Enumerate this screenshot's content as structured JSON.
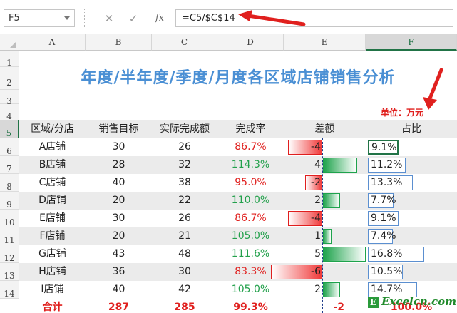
{
  "formula_bar": {
    "name_box": "F5",
    "cancel_glyph": "✕",
    "enter_glyph": "✓",
    "fx_label": "fx",
    "formula": "=C5/$C$14"
  },
  "columns": [
    "A",
    "B",
    "C",
    "D",
    "E",
    "F"
  ],
  "rows": [
    "1",
    "2",
    "3",
    "4",
    "5",
    "6",
    "7",
    "8",
    "9",
    "10",
    "11",
    "12",
    "13",
    "14"
  ],
  "title": "年度/半年度/季度/月度各区域店铺销售分析",
  "unit": "单位：万元",
  "headers": {
    "region": "区域/分店",
    "target": "销售目标",
    "actual": "实际完成额",
    "rate": "完成率",
    "diff": "差额",
    "share": "占比"
  },
  "table": [
    {
      "store": "A店铺",
      "target": "30",
      "actual": "26",
      "rate": "86.7%",
      "rate_good": false,
      "diff": "-4",
      "diff_value": -4,
      "share": "9.1%",
      "share_value": 9.1
    },
    {
      "store": "B店铺",
      "target": "28",
      "actual": "32",
      "rate": "114.3%",
      "rate_good": true,
      "diff": "4",
      "diff_value": 4,
      "share": "11.2%",
      "share_value": 11.2
    },
    {
      "store": "C店铺",
      "target": "40",
      "actual": "38",
      "rate": "95.0%",
      "rate_good": false,
      "diff": "-2",
      "diff_value": -2,
      "share": "13.3%",
      "share_value": 13.3
    },
    {
      "store": "D店铺",
      "target": "20",
      "actual": "22",
      "rate": "110.0%",
      "rate_good": true,
      "diff": "2",
      "diff_value": 2,
      "share": "7.7%",
      "share_value": 7.7
    },
    {
      "store": "E店铺",
      "target": "30",
      "actual": "26",
      "rate": "86.7%",
      "rate_good": false,
      "diff": "-4",
      "diff_value": -4,
      "share": "9.1%",
      "share_value": 9.1
    },
    {
      "store": "F店铺",
      "target": "20",
      "actual": "21",
      "rate": "105.0%",
      "rate_good": true,
      "diff": "1",
      "diff_value": 1,
      "share": "7.4%",
      "share_value": 7.4
    },
    {
      "store": "G店铺",
      "target": "43",
      "actual": "48",
      "rate": "111.6%",
      "rate_good": true,
      "diff": "5",
      "diff_value": 5,
      "share": "16.8%",
      "share_value": 16.8
    },
    {
      "store": "H店铺",
      "target": "36",
      "actual": "30",
      "rate": "83.3%",
      "rate_good": false,
      "diff": "-6",
      "diff_value": -6,
      "share": "10.5%",
      "share_value": 10.5
    },
    {
      "store": "I店铺",
      "target": "40",
      "actual": "42",
      "rate": "105.0%",
      "rate_good": true,
      "diff": "2",
      "diff_value": 2,
      "share": "14.7%",
      "share_value": 14.7
    }
  ],
  "total": {
    "label": "合计",
    "target": "287",
    "actual": "285",
    "rate": "99.3%",
    "diff": "-2",
    "share": "100.0%"
  },
  "selected_cell": "F5",
  "watermark": {
    "mark": "E",
    "text": "Excelcn.com"
  },
  "colors": {
    "title": "#4a8fd4",
    "good": "#22a04b",
    "bad": "#e0201e",
    "accent": "#217346"
  }
}
